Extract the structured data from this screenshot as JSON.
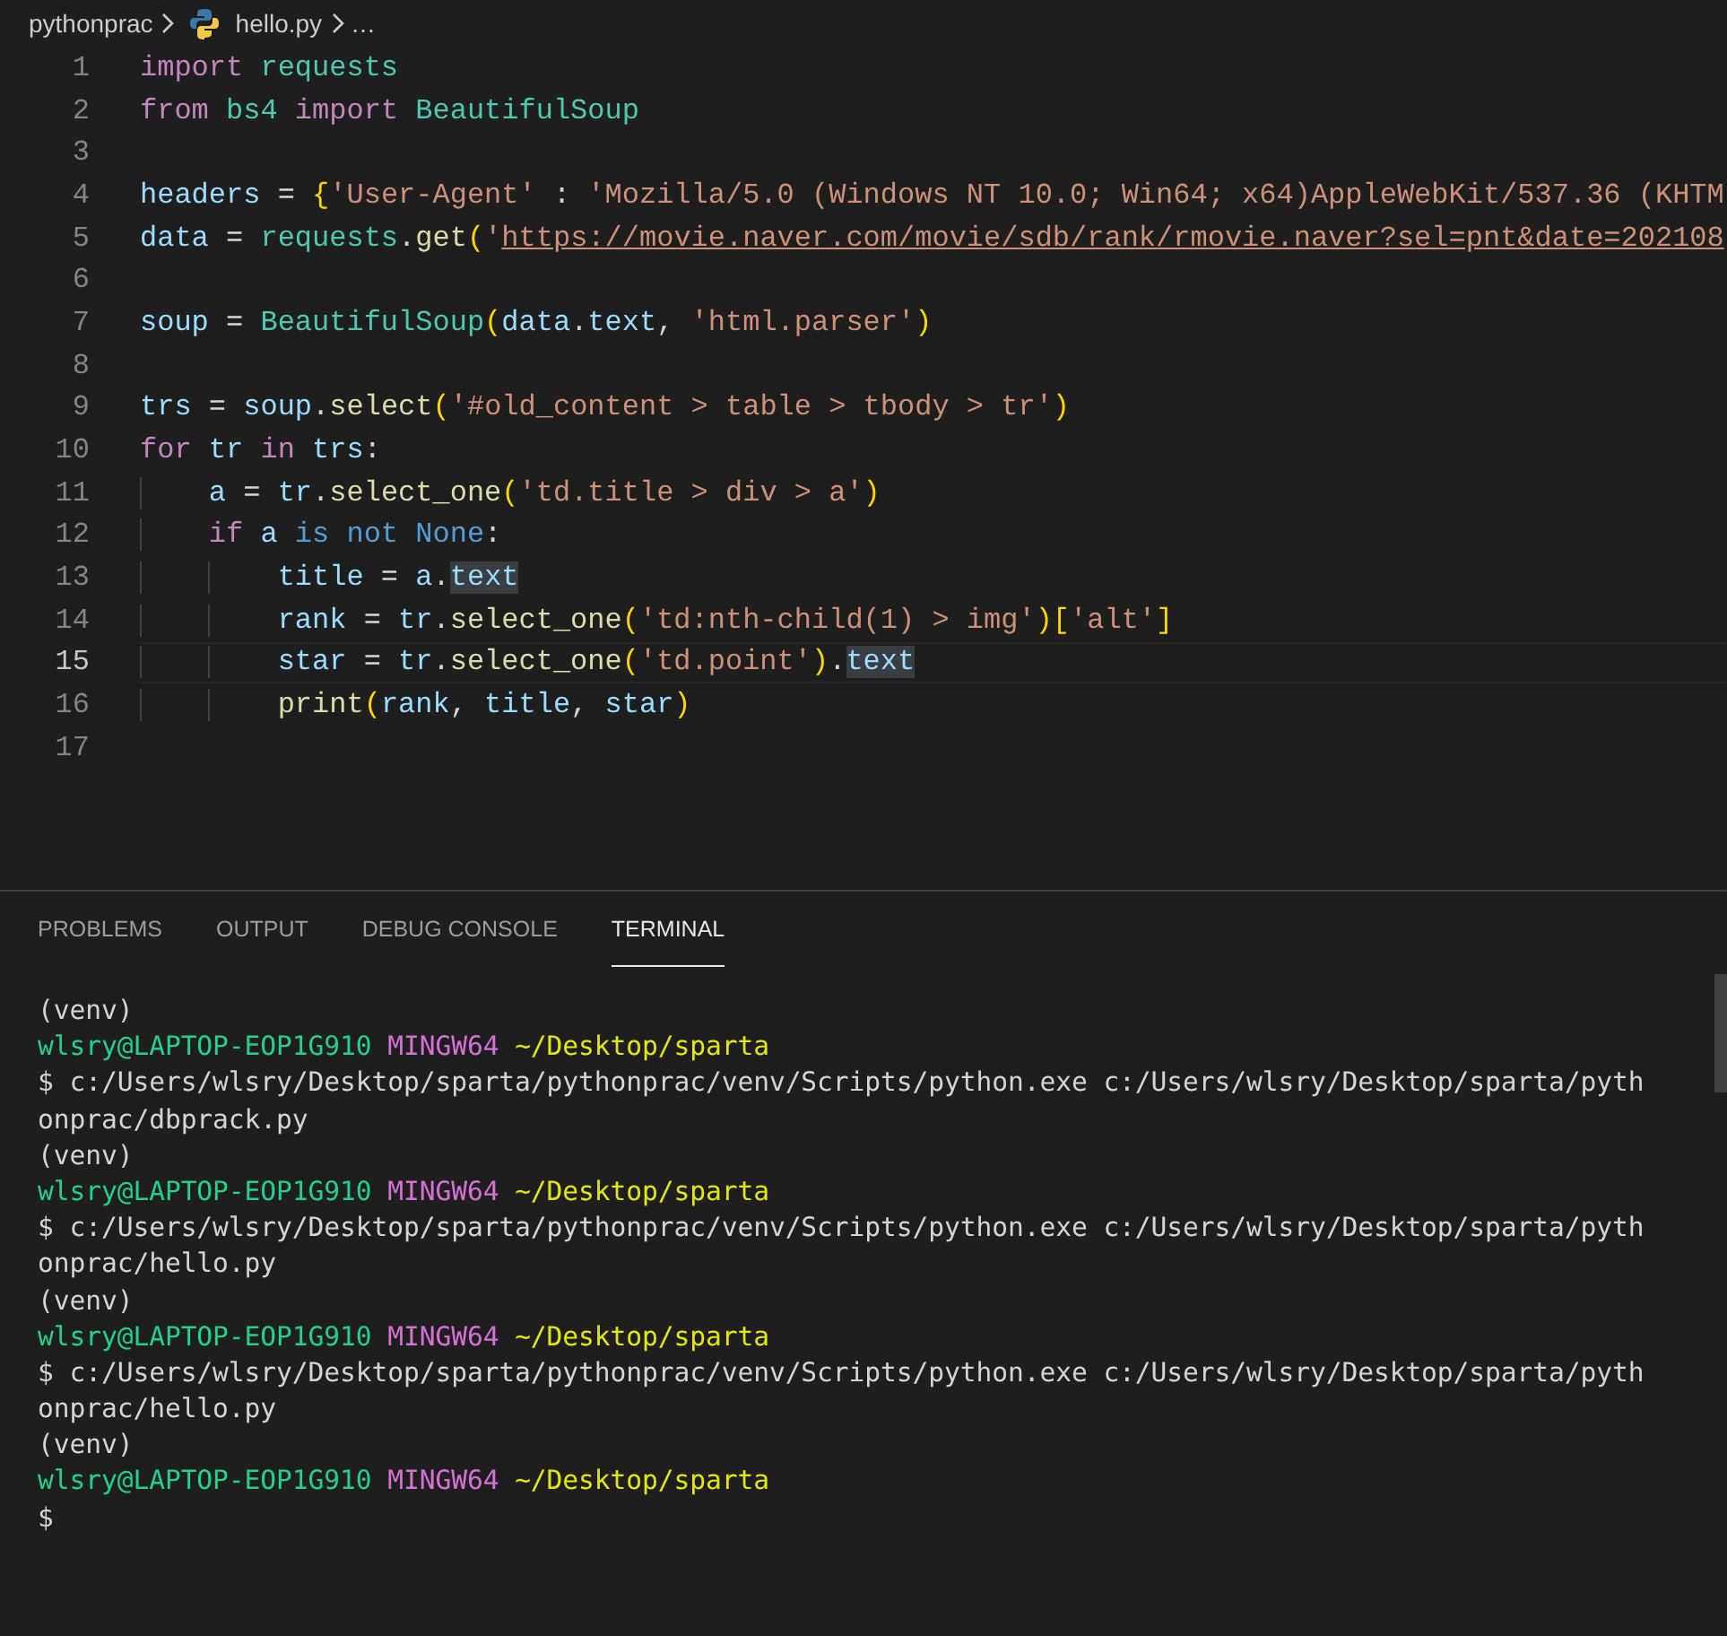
{
  "breadcrumb": {
    "folder": "pythonprac",
    "file": "hello.py",
    "more": "…"
  },
  "editor": {
    "lines": [
      {
        "number": "1",
        "current": false,
        "tokens": [
          {
            "text": "import ",
            "kind": "kw"
          },
          {
            "text": "requests",
            "kind": "mod"
          }
        ]
      },
      {
        "number": "2",
        "current": false,
        "tokens": [
          {
            "text": "from ",
            "kind": "kw"
          },
          {
            "text": "bs4 ",
            "kind": "mod"
          },
          {
            "text": "import ",
            "kind": "kw"
          },
          {
            "text": "BeautifulSoup",
            "kind": "mod"
          }
        ]
      },
      {
        "number": "3",
        "current": false
      },
      {
        "number": "4",
        "current": false,
        "tokens": [
          {
            "text": "headers",
            "kind": "var"
          },
          {
            "text": " = ",
            "kind": "plain"
          },
          {
            "text": "{",
            "kind": "br"
          },
          {
            "text": "'User-Agent'",
            "kind": "str"
          },
          {
            "text": " : ",
            "kind": "plain"
          },
          {
            "text": "'Mozilla/5.0 (Windows NT 10.0; Win64; x64)AppleWebKit/537.36 (KHTM",
            "kind": "str"
          }
        ]
      },
      {
        "number": "5",
        "current": false,
        "tokens": [
          {
            "text": "data",
            "kind": "var"
          },
          {
            "text": " = ",
            "kind": "plain"
          },
          {
            "text": "requests",
            "kind": "mod"
          },
          {
            "text": ".",
            "kind": "plain"
          },
          {
            "text": "get",
            "kind": "fn"
          },
          {
            "text": "(",
            "kind": "br"
          },
          {
            "text": "'",
            "kind": "str"
          },
          {
            "text": "https://movie.naver.com/movie/sdb/rank/rmovie.naver?sel=pnt&date=202108",
            "kind": "url"
          }
        ]
      },
      {
        "number": "6",
        "current": false
      },
      {
        "number": "7",
        "current": false,
        "tokens": [
          {
            "text": "soup",
            "kind": "var"
          },
          {
            "text": " = ",
            "kind": "plain"
          },
          {
            "text": "BeautifulSoup",
            "kind": "mod"
          },
          {
            "text": "(",
            "kind": "br"
          },
          {
            "text": "data",
            "kind": "var"
          },
          {
            "text": ".",
            "kind": "plain"
          },
          {
            "text": "text",
            "kind": "var"
          },
          {
            "text": ", ",
            "kind": "plain"
          },
          {
            "text": "'html.parser'",
            "kind": "str"
          },
          {
            "text": ")",
            "kind": "br"
          }
        ]
      },
      {
        "number": "8",
        "current": false
      },
      {
        "number": "9",
        "current": false,
        "tokens": [
          {
            "text": "trs",
            "kind": "var"
          },
          {
            "text": " = ",
            "kind": "plain"
          },
          {
            "text": "soup",
            "kind": "var"
          },
          {
            "text": ".",
            "kind": "plain"
          },
          {
            "text": "select",
            "kind": "fn"
          },
          {
            "text": "(",
            "kind": "br"
          },
          {
            "text": "'#old_content > table > tbody > tr'",
            "kind": "str"
          },
          {
            "text": ")",
            "kind": "br"
          }
        ]
      },
      {
        "number": "10",
        "current": false,
        "tokens": [
          {
            "text": "for ",
            "kind": "kw"
          },
          {
            "text": "tr ",
            "kind": "var"
          },
          {
            "text": "in ",
            "kind": "kw"
          },
          {
            "text": "trs",
            "kind": "var"
          },
          {
            "text": ":",
            "kind": "plain"
          }
        ]
      },
      {
        "number": "11",
        "current": false,
        "tokens": [
          {
            "text": "    a",
            "kind": "var"
          },
          {
            "text": " = ",
            "kind": "plain"
          },
          {
            "text": "tr",
            "kind": "var"
          },
          {
            "text": ".",
            "kind": "plain"
          },
          {
            "text": "select_one",
            "kind": "fn"
          },
          {
            "text": "(",
            "kind": "br"
          },
          {
            "text": "'td.title > div > a'",
            "kind": "str"
          },
          {
            "text": ")",
            "kind": "br"
          }
        ]
      },
      {
        "number": "12",
        "current": false,
        "tokens": [
          {
            "text": "    if ",
            "kind": "kw"
          },
          {
            "text": "a ",
            "kind": "var"
          },
          {
            "text": "is not None",
            "kind": "kw2"
          },
          {
            "text": ":",
            "kind": "plain"
          }
        ]
      },
      {
        "number": "13",
        "current": false,
        "tokens": [
          {
            "text": "        title",
            "kind": "var"
          },
          {
            "text": " = ",
            "kind": "plain"
          },
          {
            "text": "a",
            "kind": "var"
          },
          {
            "text": ".",
            "kind": "plain"
          },
          {
            "text": "text",
            "kind": "match"
          }
        ]
      },
      {
        "number": "14",
        "current": false,
        "tokens": [
          {
            "text": "        rank",
            "kind": "var"
          },
          {
            "text": " = ",
            "kind": "plain"
          },
          {
            "text": "tr",
            "kind": "var"
          },
          {
            "text": ".",
            "kind": "plain"
          },
          {
            "text": "select_one",
            "kind": "fn"
          },
          {
            "text": "(",
            "kind": "br"
          },
          {
            "text": "'td:nth-child(1) > img'",
            "kind": "str"
          },
          {
            "text": ")[",
            "kind": "br"
          },
          {
            "text": "'alt'",
            "kind": "str"
          },
          {
            "text": "]",
            "kind": "br"
          }
        ]
      },
      {
        "number": "15",
        "current": true,
        "tokens": [
          {
            "text": "        star",
            "kind": "var"
          },
          {
            "text": " = ",
            "kind": "plain"
          },
          {
            "text": "tr",
            "kind": "var"
          },
          {
            "text": ".",
            "kind": "plain"
          },
          {
            "text": "select_one",
            "kind": "fn"
          },
          {
            "text": "(",
            "kind": "br"
          },
          {
            "text": "'td.point'",
            "kind": "str"
          },
          {
            "text": ")",
            "kind": "br"
          },
          {
            "text": ".",
            "kind": "plain"
          },
          {
            "text": "text",
            "kind": "match"
          }
        ]
      },
      {
        "number": "16",
        "current": false,
        "tokens": [
          {
            "text": "        print",
            "kind": "fn"
          },
          {
            "text": "(",
            "kind": "br"
          },
          {
            "text": "rank",
            "kind": "var"
          },
          {
            "text": ", ",
            "kind": "plain"
          },
          {
            "text": "title",
            "kind": "var"
          },
          {
            "text": ", ",
            "kind": "plain"
          },
          {
            "text": "star",
            "kind": "var"
          },
          {
            "text": ")",
            "kind": "br"
          }
        ]
      },
      {
        "number": "17",
        "current": false
      }
    ]
  },
  "panel": {
    "tabs": [
      {
        "label": "PROBLEMS",
        "selected": false
      },
      {
        "label": "OUTPUT",
        "selected": false
      },
      {
        "label": "DEBUG CONSOLE",
        "selected": false
      },
      {
        "label": "TERMINAL",
        "selected": true
      }
    ]
  },
  "terminal": {
    "lines": [
      {
        "tokens": [
          {
            "text": "(venv)",
            "kind": "plain"
          }
        ]
      },
      {
        "tokens": [
          {
            "text": "wlsry@LAPTOP-EOP1G910 ",
            "kind": "user"
          },
          {
            "text": "MINGW64 ",
            "kind": "sys"
          },
          {
            "text": "~/Desktop/sparta",
            "kind": "path"
          }
        ]
      },
      {
        "tokens": [
          {
            "text": "$ c:/Users/wlsry/Desktop/sparta/pythonprac/venv/Scripts/python.exe c:/Users/wlsry/Desktop/sparta/pyth",
            "kind": "plain"
          }
        ]
      },
      {
        "tokens": [
          {
            "text": "onprac/dbprack.py",
            "kind": "plain"
          }
        ]
      },
      {
        "tokens": [
          {
            "text": "(venv)",
            "kind": "plain"
          }
        ]
      },
      {
        "tokens": [
          {
            "text": "wlsry@LAPTOP-EOP1G910 ",
            "kind": "user"
          },
          {
            "text": "MINGW64 ",
            "kind": "sys"
          },
          {
            "text": "~/Desktop/sparta",
            "kind": "path"
          }
        ]
      },
      {
        "tokens": [
          {
            "text": "$ c:/Users/wlsry/Desktop/sparta/pythonprac/venv/Scripts/python.exe c:/Users/wlsry/Desktop/sparta/pyth",
            "kind": "plain"
          }
        ]
      },
      {
        "tokens": [
          {
            "text": "onprac/hello.py",
            "kind": "plain"
          }
        ]
      },
      {
        "tokens": [
          {
            "text": "(venv)",
            "kind": "plain"
          }
        ]
      },
      {
        "tokens": [
          {
            "text": "wlsry@LAPTOP-EOP1G910 ",
            "kind": "user"
          },
          {
            "text": "MINGW64 ",
            "kind": "sys"
          },
          {
            "text": "~/Desktop/sparta",
            "kind": "path"
          }
        ]
      },
      {
        "tokens": [
          {
            "text": "$ c:/Users/wlsry/Desktop/sparta/pythonprac/venv/Scripts/python.exe c:/Users/wlsry/Desktop/sparta/pyth",
            "kind": "plain"
          }
        ]
      },
      {
        "tokens": [
          {
            "text": "onprac/hello.py",
            "kind": "plain"
          }
        ]
      },
      {
        "tokens": [
          {
            "text": "(venv)",
            "kind": "plain"
          }
        ]
      },
      {
        "tokens": [
          {
            "text": "wlsry@LAPTOP-EOP1G910 ",
            "kind": "user"
          },
          {
            "text": "MINGW64 ",
            "kind": "sys"
          },
          {
            "text": "~/Desktop/sparta",
            "kind": "path"
          }
        ]
      },
      {
        "tokens": [
          {
            "text": "$",
            "kind": "plain"
          }
        ]
      }
    ]
  }
}
